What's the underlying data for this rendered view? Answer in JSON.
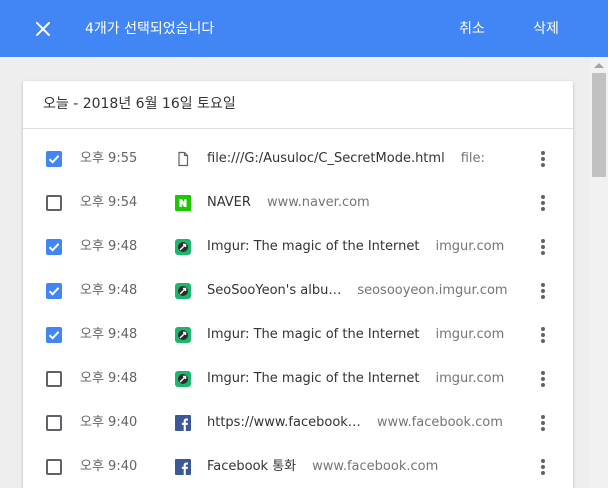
{
  "toolbar": {
    "selected_count_text": "4개가 선택되었습니다",
    "cancel_label": "취소",
    "delete_label": "삭제"
  },
  "card": {
    "header": "오늘 - 2018년 6월 16일 토요일"
  },
  "rows": [
    {
      "checked": true,
      "time": "오후 9:55",
      "favicon": "file-icon",
      "title": "file:///G:/Ausuloc/C_SecretMode.html",
      "domain": "file:"
    },
    {
      "checked": false,
      "time": "오후 9:54",
      "favicon": "naver-icon",
      "title": "NAVER",
      "domain": "www.naver.com"
    },
    {
      "checked": true,
      "time": "오후 9:48",
      "favicon": "imgur-icon",
      "title": "Imgur: The magic of the Internet",
      "domain": "imgur.com"
    },
    {
      "checked": true,
      "time": "오후 9:48",
      "favicon": "imgur-icon",
      "title": "SeoSooYeon's albu…",
      "domain": "seosooyeon.imgur.com"
    },
    {
      "checked": true,
      "time": "오후 9:48",
      "favicon": "imgur-icon",
      "title": "Imgur: The magic of the Internet",
      "domain": "imgur.com"
    },
    {
      "checked": false,
      "time": "오후 9:48",
      "favicon": "imgur-icon",
      "title": "Imgur: The magic of the Internet",
      "domain": "imgur.com"
    },
    {
      "checked": false,
      "time": "오후 9:40",
      "favicon": "facebook-icon",
      "title": "https://www.facebook…",
      "domain": "www.facebook.com"
    },
    {
      "checked": false,
      "time": "오후 9:40",
      "favicon": "facebook-icon",
      "title": "Facebook 통화",
      "domain": "www.facebook.com"
    }
  ],
  "colors": {
    "toolbar": "#4285f4",
    "checkbox_checked": "#4285f4",
    "naver_green": "#1ec800",
    "facebook_blue": "#3b5998",
    "imgur_teal": "#1bb76e"
  }
}
